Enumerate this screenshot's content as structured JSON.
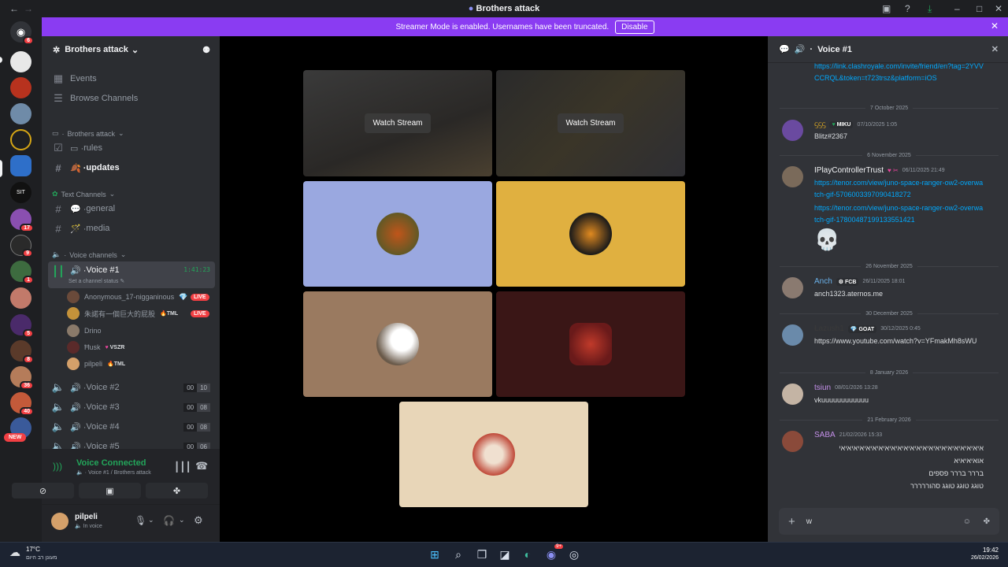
{
  "window": {
    "title": "Brothers attack"
  },
  "banner": {
    "text": "Streamer Mode is enabled. Usernames have been truncated.",
    "disable_label": "Disable"
  },
  "colors": {
    "accent": "#8a3cf2",
    "live": "#f23f43",
    "voice_green": "#23a55a",
    "link": "#00a8fc"
  },
  "servers": {
    "badges": [
      "6",
      "17",
      "9",
      "1",
      "5",
      "8",
      "36",
      "40"
    ],
    "new_label": "NEW"
  },
  "sidebar": {
    "server_name": "Brothers attack",
    "events_label": "Events",
    "browse_label": "Browse Channels",
    "cat_server": "Brothers attack",
    "rules": "rules",
    "updates": "updates",
    "cat_text": "Text Channels",
    "general": "general",
    "media": "media",
    "cat_voice": "Voice channels",
    "voice1": "Voice #1",
    "voice1_timer": "1:41:23",
    "voice1_status": "Set a channel status",
    "voice_users": [
      {
        "name": "Anonymous_17-nigganinous",
        "tag": "",
        "live": "LIVE"
      },
      {
        "name": "朱諾有一個巨大的屁股",
        "tag": "TML",
        "live": "LIVE"
      },
      {
        "name": "Drino",
        "tag": "",
        "live": ""
      },
      {
        "name": "Ħusk",
        "tag": "VSZR",
        "live": ""
      },
      {
        "name": "pilpeli",
        "tag": "TML",
        "live": ""
      }
    ],
    "voice2": "Voice #2",
    "voice2_count": [
      "00",
      "10"
    ],
    "voice3": "Voice #3",
    "voice3_count": [
      "00",
      "08"
    ],
    "voice4": "Voice #4",
    "voice4_count": [
      "00",
      "08"
    ],
    "voice5": "Voice #5",
    "voice5_count": [
      "00",
      "06"
    ]
  },
  "voice_panel": {
    "status": "Voice Connected",
    "location": "Voice #1 / Brothers attack"
  },
  "user_panel": {
    "name": "pilpeli",
    "status": "In voice"
  },
  "stage": {
    "watch_label_1": "Watch Stream",
    "watch_label_2": "Watch Stream"
  },
  "chat": {
    "header": "Voice #1",
    "top_link": "https://link.clashroyale.com/invite/friend/en?tag=2YVVCCRQL&token=t723trsz&platform=iOS",
    "divider_1": "7 October 2025",
    "m1": {
      "name": "ᦓᦓᦓ",
      "badge": "MIKU",
      "ts": "07/10/2025 1:05",
      "text": "Blitz#2367"
    },
    "divider_2": "6 November 2025",
    "m2": {
      "name": "IPlayControllerTrust",
      "badge": "",
      "ts": "06/11/2025 21:49",
      "link1": "https://tenor.com/view/juno-space-ranger-ow2-overwatch-gif-5706003397090418272",
      "link2": "https://tenor.com/view/juno-space-ranger-ow2-overwatch-gif-17800487199133551421",
      "emoji": "💀"
    },
    "divider_3": "26 November 2025",
    "m3": {
      "name": "Anch",
      "badge": "FCB",
      "ts": "26/11/2025 18:01",
      "text": "anch1323.aternos.me"
    },
    "divider_4": "30 December 2025",
    "m4": {
      "name": "Łazush1",
      "badge": "GOAT",
      "ts": "30/12/2025 0:45",
      "link": "https://www.youtube.com/watch?v=YFmakMh8sWU"
    },
    "divider_5": "8 January 2026",
    "m5": {
      "name": "tsiun",
      "ts": "08/01/2026 13:28",
      "text": "vkuuuuuuuuuuuu"
    },
    "divider_6": "21 February 2026",
    "m6": {
      "name": "SABA",
      "ts": "21/02/2026 15:33",
      "line1": "איאיאיאיאיאיאיאיאיאיאיאיאיאיאיאיאיאיאיאיאיאיאי",
      "line2": "אואיאיאיא",
      "line3": "בררר בררר פספים",
      "line4": "טוגג טוגג טוגג סהוררררר"
    },
    "composer_value": "w"
  },
  "taskbar": {
    "temp": "17°C",
    "weather": "מעונן רב היום",
    "time": "19:42",
    "date": "26/02/2026",
    "discord_badge": "9+"
  }
}
